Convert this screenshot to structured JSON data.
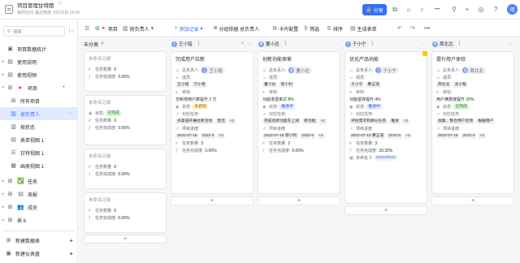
{
  "header": {
    "title": "项目管理甘特图",
    "location": "我的空间",
    "modified": "最近修改: 9月23日 14:10",
    "share_label": "分享",
    "avatar_text": "用"
  },
  "sidebar": {
    "search_placeholder": "搜索",
    "items": [
      {
        "label": "项目数据统计",
        "icon": "dashboard-icon"
      },
      {
        "label": "使用说明",
        "icon": "doc-icon"
      },
      {
        "label": "使用视频",
        "icon": "doc-icon"
      },
      {
        "label": "项目",
        "icon": "table-icon"
      },
      {
        "label": "所有项目",
        "icon": "grid-icon"
      },
      {
        "label": "按负责人",
        "icon": "kanban-icon"
      },
      {
        "label": "按状态",
        "icon": "kanban-icon"
      },
      {
        "label": "表单视图 1",
        "icon": "form-icon"
      },
      {
        "label": "甘特视图 1",
        "icon": "gantt-icon"
      },
      {
        "label": "画册视图 1",
        "icon": "gallery-icon"
      },
      {
        "label": "任务",
        "icon": "check-icon"
      },
      {
        "label": "周报",
        "icon": "report-icon"
      },
      {
        "label": "成员",
        "icon": "people-icon"
      },
      {
        "label": "表 6",
        "icon": "table-icon"
      }
    ],
    "new_dashboard": "新建数据表",
    "new_instrument": "新建仪表盘"
  },
  "toolbar": {
    "table_name": "项目",
    "view_name": "按负责人",
    "add_record": "添加记录",
    "group": "分组依据 总负责人",
    "card_config": "卡片配置",
    "filter": "筛选",
    "sort": "排序",
    "generate_form": "生成表单"
  },
  "labels": {
    "owner": "总负责人:",
    "members": "成员:",
    "goal": "目标:",
    "status": "状态:",
    "okr": "对应任务:",
    "cycle": "项目进度:",
    "task_count": "任务数量:",
    "done_rate": "任务完成度:",
    "deadline": "未命名 2:"
  },
  "columns": [
    {
      "name": "未分类",
      "count": "4",
      "cards": [
        {
          "title": "未命名记录",
          "task_count": "0",
          "done_rate": "0.00%"
        },
        {
          "title": "未命名记录",
          "status": "已完成",
          "task_count": "0",
          "done_rate": "0.00%"
        },
        {
          "title": "未命名记录",
          "task_count": "0",
          "done_rate": "0.00%"
        },
        {
          "title": "未命名记录",
          "task_count": "0",
          "done_rate": "0.00%"
        }
      ]
    },
    {
      "name": "王小铭",
      "count": "1",
      "card": {
        "title": "完成用户拉新",
        "owner": "王小铭",
        "members": [
          "王小铭",
          "万小奇"
        ],
        "goal": "日新增用户数提升 2 万",
        "status": "未启动",
        "tasks": [
          "多渠道开展拉新活动",
          "激活",
          "+1"
        ],
        "dates": [
          "2022-07-15",
          "2022-0",
          "+2"
        ],
        "task_count": "3",
        "done_rate": "0.00%"
      }
    },
    {
      "name": "董小达",
      "count": "1",
      "card": {
        "title": "创新功能探索",
        "owner": "董小达",
        "members": [
          "董小达",
          "邬小利"
        ],
        "goal": "功能渗透率达 8%",
        "status": "推进中",
        "tasks": [
          "完成创新功能灰上线",
          "新功能",
          "+1"
        ],
        "dates": [
          "2022-07-15 邬小利",
          "2022-0",
          "+2"
        ],
        "task_count": "2",
        "done_rate": "0.00%"
      }
    },
    {
      "name": "于小宁",
      "count": "1",
      "card": {
        "title": "优化产品功能",
        "owner": "于小宁",
        "members": [
          "于小宁",
          "黄言浩"
        ],
        "goal": "功能留存提升 4%",
        "status": "推进中",
        "tasks": [
          "评估需求和做分任务",
          "推进",
          "+1"
        ],
        "dates": [
          "2022-07-15 黄言浩",
          "2022-0",
          "+2"
        ],
        "task_count": "3",
        "done_rate": "33.33%",
        "deadline": "2022/09/23"
      }
    },
    {
      "name": "周北北",
      "count": "1",
      "card": {
        "title": "提升用户体验",
        "owner": "周北北",
        "members": [
          "周北北",
          "沈小蔡"
        ],
        "goal": "用户满意度提升 20%",
        "status": "已完成",
        "tasks": [
          "收集、整合用户反馈",
          "根据用户"
        ],
        "dates": [
          "2022-07-15",
          "2022-0",
          "+2"
        ],
        "task_count": "",
        "done_rate": ""
      }
    }
  ],
  "colors": {
    "accent": "#3370ff",
    "not_started_bg": "#fff0c2",
    "not_started": "#8f5c00",
    "in_progress_bg": "#e1eaff",
    "in_progress": "#245bdb",
    "done_bg": "#d9f5d6",
    "done": "#237b19"
  }
}
